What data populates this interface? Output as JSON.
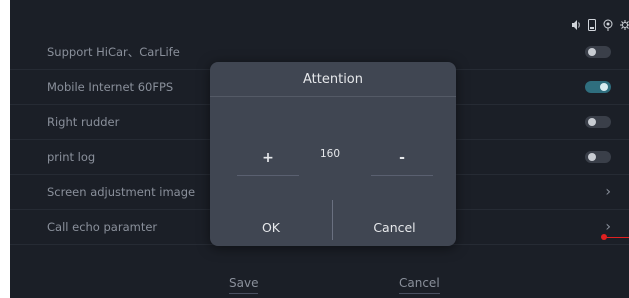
{
  "status_bar": {
    "icons": [
      "volume-icon",
      "phone-icon",
      "wireless-icon",
      "brightness-icon"
    ]
  },
  "settings": [
    {
      "label": "Support HiCar、CarLife",
      "control": "toggle",
      "state": "off"
    },
    {
      "label": "Mobile Internet 60FPS",
      "control": "toggle",
      "state": "on"
    },
    {
      "label": "Right rudder",
      "control": "toggle",
      "state": "off"
    },
    {
      "label": "print log",
      "control": "toggle",
      "state": "off"
    },
    {
      "label": "Screen adjustment image",
      "control": "chevron"
    },
    {
      "label": "Call echo paramter",
      "control": "chevron"
    }
  ],
  "bottom": {
    "save_label": "Save",
    "cancel_label": "Cancel"
  },
  "dialog": {
    "title": "Attention",
    "plus_label": "+",
    "minus_label": "-",
    "value": "160",
    "ok_label": "OK",
    "cancel_label": "Cancel"
  },
  "colors": {
    "background": "#1b1f27",
    "dialog": "#404652",
    "toggle_on": "#2f6e7e",
    "annotation": "#e02020"
  }
}
